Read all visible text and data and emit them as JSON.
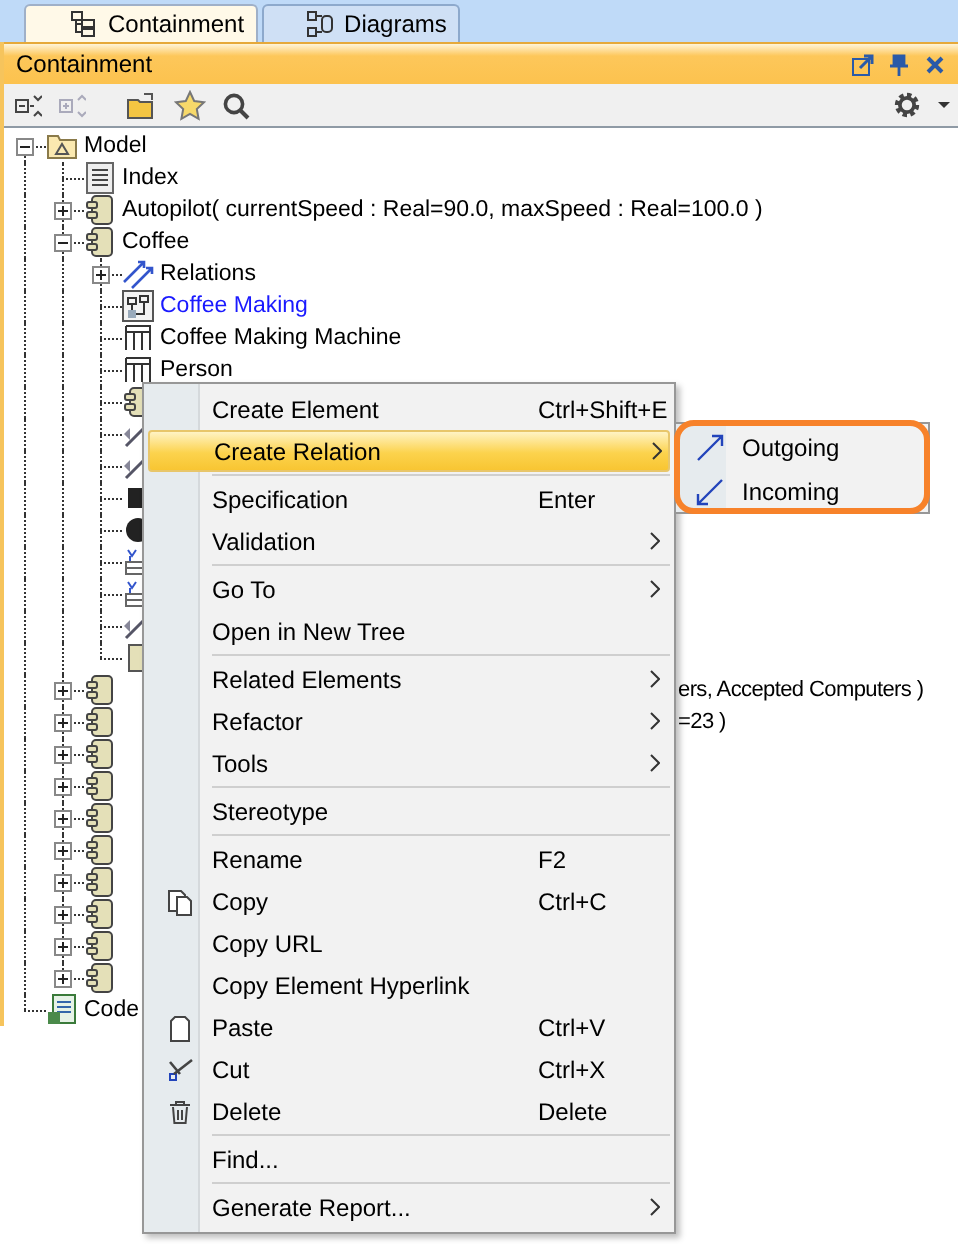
{
  "tabs": [
    {
      "label": "Containment",
      "selected": true
    },
    {
      "label": "Diagrams",
      "selected": false
    }
  ],
  "panel": {
    "title": "Containment"
  },
  "tree": [
    {
      "label": "Model",
      "kind": "package",
      "expanded": true,
      "children": [
        {
          "label": "Index",
          "kind": "document"
        },
        {
          "label": "Autopilot( currentSpeed : Real=90.0, maxSpeed : Real=100.0 )",
          "kind": "component",
          "expanded": false
        },
        {
          "label": "Coffee",
          "kind": "component",
          "expanded": true,
          "children": [
            {
              "label": "Relations",
              "kind": "relations",
              "expanded": false
            },
            {
              "label": "Coffee Making",
              "kind": "diagram"
            },
            {
              "label": "Coffee Making Machine",
              "kind": "block"
            },
            {
              "label": "Person",
              "kind": "block"
            },
            {
              "kind": "part"
            },
            {
              "kind": "link"
            },
            {
              "kind": "link"
            },
            {
              "kind": "port"
            },
            {
              "kind": "state"
            },
            {
              "kind": "flow"
            },
            {
              "kind": "flow"
            },
            {
              "kind": "link"
            },
            {
              "kind": "box"
            }
          ]
        },
        {
          "tail": "ers, Accepted Computers )",
          "kind": "component",
          "expanded": false
        },
        {
          "tail": "=23 )",
          "kind": "component",
          "expanded": false
        },
        {
          "kind": "component",
          "expanded": false
        },
        {
          "kind": "component",
          "expanded": false
        },
        {
          "kind": "component",
          "expanded": false
        },
        {
          "kind": "component",
          "expanded": false
        },
        {
          "kind": "component",
          "expanded": false
        },
        {
          "kind": "component",
          "expanded": false
        },
        {
          "kind": "component",
          "expanded": false
        },
        {
          "kind": "component",
          "expanded": false
        }
      ]
    },
    {
      "label": "Code",
      "kind": "code"
    }
  ],
  "menu": {
    "groups": [
      [
        {
          "label": "Create Element",
          "shortcut": "Ctrl+Shift+E",
          "submenu": false,
          "selected": false
        },
        {
          "label": "Create Relation",
          "submenu": true,
          "selected": true
        }
      ],
      [
        {
          "label": "Specification",
          "shortcut": "Enter",
          "submenu": false,
          "selected": false
        },
        {
          "label": "Validation",
          "submenu": true,
          "selected": false
        }
      ],
      [
        {
          "label": "Go To",
          "submenu": true,
          "selected": false
        },
        {
          "label": "Open in New Tree",
          "submenu": false,
          "selected": false
        }
      ],
      [
        {
          "label": "Related Elements",
          "submenu": true,
          "selected": false
        },
        {
          "label": "Refactor",
          "submenu": true,
          "selected": false
        },
        {
          "label": "Tools",
          "submenu": true,
          "selected": false
        }
      ],
      [
        {
          "label": "Stereotype",
          "submenu": false,
          "selected": false
        }
      ],
      [
        {
          "label": "Rename",
          "shortcut": "F2",
          "submenu": false,
          "selected": false
        },
        {
          "label": "Copy",
          "shortcut": "Ctrl+C",
          "submenu": false,
          "selected": false
        },
        {
          "label": "Copy URL",
          "submenu": false,
          "selected": false
        },
        {
          "label": "Copy Element Hyperlink",
          "submenu": false,
          "selected": false
        },
        {
          "label": "Paste",
          "shortcut": "Ctrl+V",
          "submenu": false,
          "selected": false
        },
        {
          "label": "Cut",
          "shortcut": "Ctrl+X",
          "submenu": false,
          "selected": false
        },
        {
          "label": "Delete",
          "shortcut": "Delete",
          "submenu": false,
          "selected": false
        }
      ],
      [
        {
          "label": "Find...",
          "submenu": false,
          "selected": false
        }
      ],
      [
        {
          "label": "Generate Report...",
          "submenu": true,
          "selected": false
        }
      ]
    ]
  },
  "submenu": {
    "items": [
      {
        "label": "Outgoing"
      },
      {
        "label": "Incoming"
      }
    ]
  }
}
